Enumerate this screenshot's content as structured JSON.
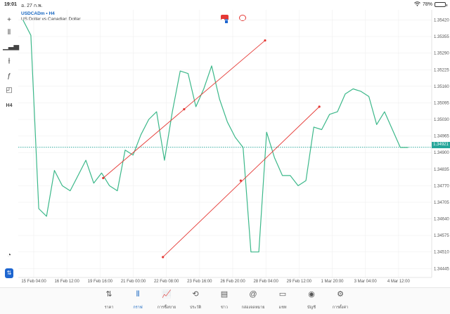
{
  "status": {
    "time": "19:01",
    "date": "อ. 27 ก.พ.",
    "battery": "78%",
    "battery_level": 0.78
  },
  "symbol": {
    "name": "USDCADm • H4",
    "description": "US Dollar vs Canadian Dollar"
  },
  "left_tools": [
    {
      "icon": "crosshair-icon",
      "glyph": "+"
    },
    {
      "icon": "candlestick-icon",
      "glyph": "⫴"
    },
    {
      "icon": "volume-bars-icon",
      "glyph": "▁▃▅"
    },
    {
      "icon": "indicator-sliders-icon",
      "glyph": "⫲"
    },
    {
      "icon": "function-icon",
      "glyph": "ƒ"
    },
    {
      "icon": "drawing-shapes-icon",
      "glyph": "◰"
    },
    {
      "icon": "timeframe-label",
      "glyph": "H4"
    }
  ],
  "bottom_left_icons": [
    {
      "icon": "speedometer-icon",
      "glyph": "◔"
    },
    {
      "icon": "trade-toggle-icon",
      "glyph": "⇅"
    }
  ],
  "current_price": "1.34921",
  "colors": {
    "line": "#3cb88a",
    "channel": "#e53935",
    "price_tag": "#26a69a",
    "accent": "#1565c0",
    "grid": "#efefef"
  },
  "chart_data": {
    "type": "line",
    "x": [
      "15 Feb 04:00",
      "16 Feb 12:00",
      "19 Feb 16:00",
      "21 Feb 00:00",
      "22 Feb 08:00",
      "23 Feb 16:00",
      "26 Feb 20:00",
      "28 Feb 04:00",
      "29 Feb 12:00",
      "1 Mar 20:00",
      "3 Mar 04:00",
      "4 Mar 12:00"
    ],
    "y_ticks": [
      "1.35420",
      "1.35355",
      "1.35290",
      "1.35225",
      "1.35160",
      "1.35095",
      "1.35030",
      "1.34965",
      "1.34900",
      "1.34835",
      "1.34770",
      "1.34705",
      "1.34640",
      "1.34575",
      "1.34510",
      "1.34445"
    ],
    "ylim": [
      1.3441,
      1.3546
    ],
    "series": [
      {
        "values": [
          1.3542,
          1.3536,
          1.3468,
          1.3465,
          1.3483,
          1.3477,
          1.3475,
          1.3481,
          1.3487,
          1.3478,
          1.3482,
          1.3477,
          1.3475,
          1.3491,
          1.3489,
          1.3497,
          1.3503,
          1.3506,
          1.3487,
          1.3506,
          1.3522,
          1.3521,
          1.3508,
          1.3515,
          1.3524,
          1.3511,
          1.3502,
          1.3496,
          1.3492,
          1.3451,
          1.3451,
          1.3498,
          1.3488,
          1.3481,
          1.3481,
          1.3477,
          1.3479,
          1.35,
          1.3499,
          1.3505,
          1.3506,
          1.3513,
          1.3515,
          1.3514,
          1.3512,
          1.3501,
          1.3506,
          1.3499,
          1.3492,
          1.3492
        ]
      }
    ],
    "channel_lines": [
      {
        "start": {
          "x": 10.2,
          "y": 1.348
        },
        "mid": {
          "x": 20.5,
          "y": 1.3507
        },
        "end": {
          "x": 30.8,
          "y": 1.3534
        }
      },
      {
        "start": {
          "x": 17.8,
          "y": 1.3449
        },
        "mid": {
          "x": 27.7,
          "y": 1.3479
        },
        "end": {
          "x": 37.7,
          "y": 1.3508
        }
      }
    ],
    "xlim": [
      -0.6,
      52
    ]
  },
  "bottom_nav": [
    {
      "id": "quotes",
      "icon": "quotes-arrows-icon",
      "glyph": "⇅",
      "label": "ราคา"
    },
    {
      "id": "chart",
      "icon": "chart-candles-icon",
      "glyph": "⫴",
      "label": "กราฟ",
      "active": true
    },
    {
      "id": "trade",
      "icon": "trade-chart-icon",
      "glyph": "📈",
      "label": "การซื้อขาย"
    },
    {
      "id": "history",
      "icon": "history-clock-icon",
      "glyph": "⟲",
      "label": "ประวัติ"
    },
    {
      "id": "news",
      "icon": "news-paper-icon",
      "glyph": "▤",
      "label": "ข่าว"
    },
    {
      "id": "mailbox",
      "icon": "mail-at-icon",
      "glyph": "@",
      "label": "กล่องจดหมาย"
    },
    {
      "id": "chat",
      "icon": "chat-bubble-icon",
      "glyph": "▭",
      "label": "แชท"
    },
    {
      "id": "account",
      "icon": "account-user-icon",
      "glyph": "◉",
      "label": "บัญชี"
    },
    {
      "id": "settings",
      "icon": "settings-gear-icon",
      "glyph": "⚙",
      "label": "การตั้งค่า"
    }
  ]
}
